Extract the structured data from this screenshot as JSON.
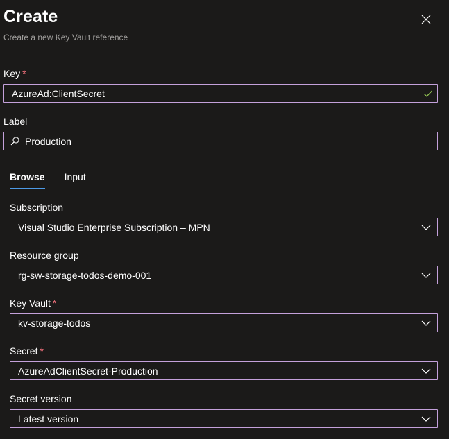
{
  "header": {
    "title": "Create",
    "subtitle": "Create a new Key Vault reference"
  },
  "key": {
    "label": "Key",
    "value": "AzureAd:ClientSecret"
  },
  "label_field": {
    "label": "Label",
    "value": "Production"
  },
  "tabs": [
    {
      "label": "Browse"
    },
    {
      "label": "Input"
    }
  ],
  "subscription": {
    "label": "Subscription",
    "value": "Visual Studio Enterprise Subscription – MPN"
  },
  "resource_group": {
    "label": "Resource group",
    "value": "rg-sw-storage-todos-demo-001"
  },
  "key_vault": {
    "label": "Key Vault",
    "value": "kv-storage-todos"
  },
  "secret": {
    "label": "Secret",
    "value": "AzureAdClientSecret-Production"
  },
  "secret_version": {
    "label": "Secret version",
    "value": "Latest version"
  },
  "required_marker": "*",
  "colors": {
    "background": "#1b1a19",
    "field_border": "#c4a1db",
    "required": "#f1707b",
    "success_check": "#92c353",
    "tab_underline": "#4d9ae6",
    "muted_text": "#a19f9d"
  },
  "icons": {
    "close": "close-icon",
    "check": "checkmark-icon",
    "search": "search-icon",
    "dropdown": "chevron-down-icon"
  }
}
